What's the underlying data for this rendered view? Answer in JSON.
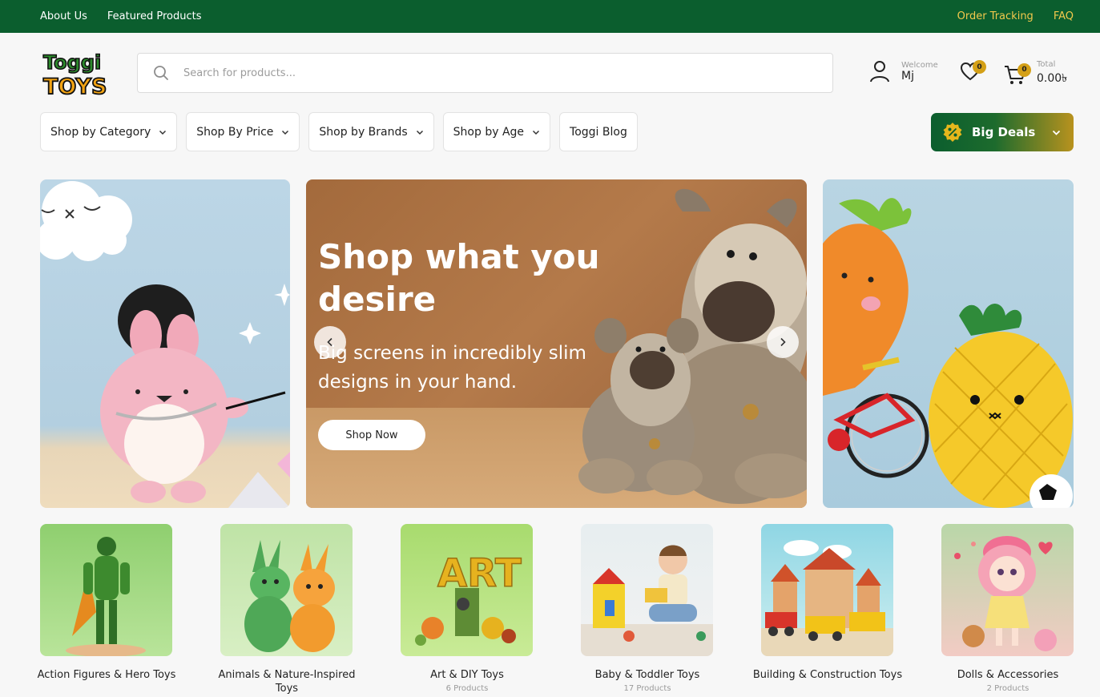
{
  "topbar": {
    "left_links": [
      "About Us",
      "Featured Products"
    ],
    "right_links": [
      "Order Tracking",
      "FAQ"
    ]
  },
  "header": {
    "logo_text": "Toggi TOYS",
    "search_placeholder": "Search for products...",
    "account": {
      "welcome": "Welcome",
      "name": "Mj",
      "icon": "user-icon"
    },
    "wishlist": {
      "count": "0",
      "icon": "heart-icon"
    },
    "cart": {
      "count": "0",
      "total_label": "Total",
      "total_value": "0.00৳",
      "icon": "cart-icon"
    }
  },
  "nav": {
    "items": [
      {
        "label": "Shop by Category",
        "dropdown": true
      },
      {
        "label": "Shop By Price",
        "dropdown": true
      },
      {
        "label": "Shop by Brands",
        "dropdown": true
      },
      {
        "label": "Shop by Age",
        "dropdown": true
      },
      {
        "label": "Toggi Blog",
        "dropdown": false
      }
    ],
    "deals": {
      "label": "Big Deals",
      "icon": "percent-badge-icon"
    }
  },
  "hero": {
    "title": "Shop what you desire",
    "subtitle": "Big screens in incredibly slim designs in your hand.",
    "button": "Shop Now"
  },
  "categories": [
    {
      "name": "Action Figures & Hero Toys",
      "count": ""
    },
    {
      "name": "Animals & Nature-Inspired Toys",
      "count": ""
    },
    {
      "name": "Art & DIY Toys",
      "count": "6 Products"
    },
    {
      "name": "Baby & Toddler Toys",
      "count": "17 Products"
    },
    {
      "name": "Building & Construction Toys",
      "count": ""
    },
    {
      "name": "Dolls & Accessories",
      "count": "2 Products"
    }
  ],
  "colors": {
    "topbar_bg": "#0b5e2e",
    "accent_gold": "#d4a017",
    "link_gold": "#f2c94c"
  }
}
